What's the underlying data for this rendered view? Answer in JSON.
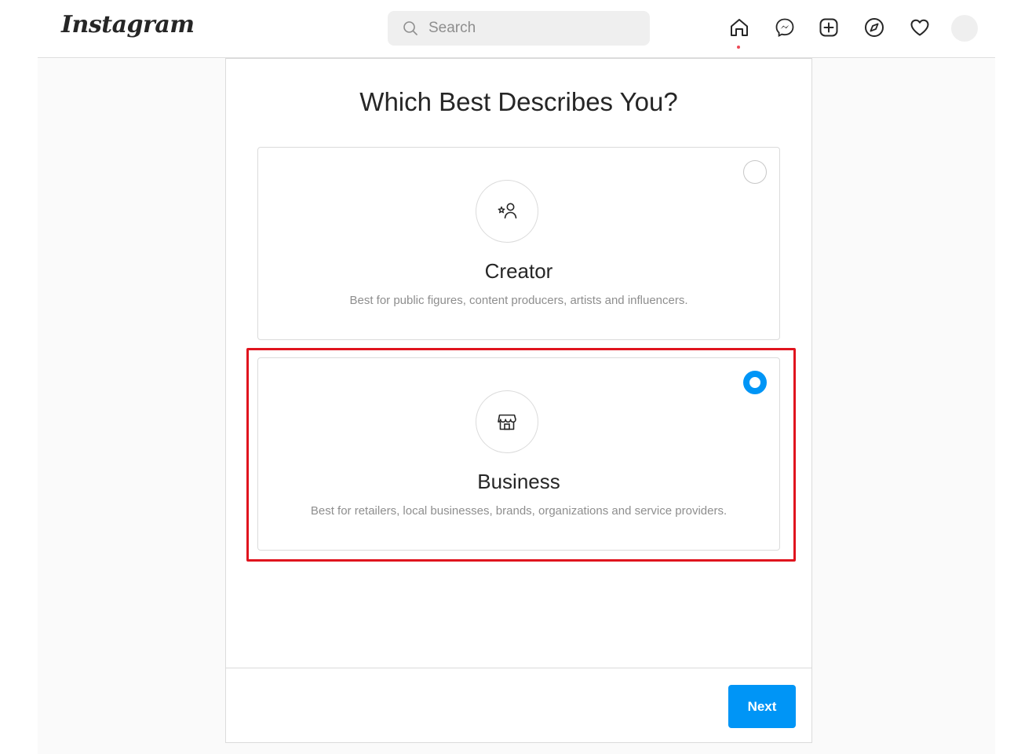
{
  "header": {
    "logo": "Instagram",
    "search": {
      "placeholder": "Search",
      "value": ""
    },
    "nav_icons": [
      "home-icon",
      "messenger-icon",
      "new-post-icon",
      "explore-icon",
      "activity-heart-icon",
      "profile-avatar"
    ]
  },
  "main": {
    "title": "Which Best Describes You?",
    "options": [
      {
        "title": "Creator",
        "description": "Best for public figures, content producers, artists and influencers.",
        "icon": "creator-icon",
        "selected": false
      },
      {
        "title": "Business",
        "description": "Best for retailers, local businesses, brands, organizations and service providers.",
        "icon": "shop-icon",
        "selected": true
      }
    ],
    "next_label": "Next"
  },
  "colors": {
    "accent": "#0095f6",
    "highlight_box": "#e0141e",
    "notification_dot": "#ed4956"
  }
}
